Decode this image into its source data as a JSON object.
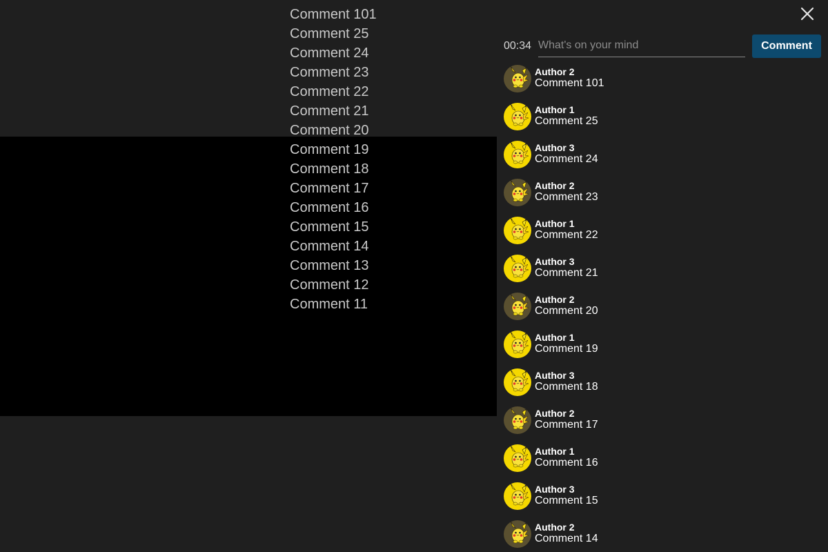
{
  "overlay_comments": [
    "Comment 101",
    "Comment 25",
    "Comment 24",
    "Comment 23",
    "Comment 22",
    "Comment 21",
    "Comment 20",
    "Comment 19",
    "Comment 18",
    "Comment 17",
    "Comment 16",
    "Comment 15",
    "Comment 14",
    "Comment 13",
    "Comment 12",
    "Comment 11"
  ],
  "close_icon": "close-icon",
  "compose": {
    "timestamp": "00:34",
    "placeholder": "What's on your mind",
    "value": "",
    "button_label": "Comment"
  },
  "comments": [
    {
      "author": "Author 2",
      "text": "Comment 101",
      "avatar": "pikachu-avatar-dark"
    },
    {
      "author": "Author 1",
      "text": "Comment 25",
      "avatar": "pikachu-avatar-yellow"
    },
    {
      "author": "Author 3",
      "text": "Comment 24",
      "avatar": "pikachu-avatar-yellow"
    },
    {
      "author": "Author 2",
      "text": "Comment 23",
      "avatar": "pikachu-avatar-dark"
    },
    {
      "author": "Author 1",
      "text": "Comment 22",
      "avatar": "pikachu-avatar-yellow"
    },
    {
      "author": "Author 3",
      "text": "Comment 21",
      "avatar": "pikachu-avatar-yellow"
    },
    {
      "author": "Author 2",
      "text": "Comment 20",
      "avatar": "pikachu-avatar-dark"
    },
    {
      "author": "Author 1",
      "text": "Comment 19",
      "avatar": "pikachu-avatar-yellow"
    },
    {
      "author": "Author 3",
      "text": "Comment 18",
      "avatar": "pikachu-avatar-yellow"
    },
    {
      "author": "Author 2",
      "text": "Comment 17",
      "avatar": "pikachu-avatar-dark"
    },
    {
      "author": "Author 1",
      "text": "Comment 16",
      "avatar": "pikachu-avatar-yellow"
    },
    {
      "author": "Author 3",
      "text": "Comment 15",
      "avatar": "pikachu-avatar-yellow"
    },
    {
      "author": "Author 2",
      "text": "Comment 14",
      "avatar": "pikachu-avatar-dark"
    }
  ],
  "colors": {
    "background": "#1f1f1f",
    "video": "#000000",
    "button": "#0d4a6e",
    "avatar_yellow": "#f5d800",
    "avatar_dark": "#5a5030"
  }
}
